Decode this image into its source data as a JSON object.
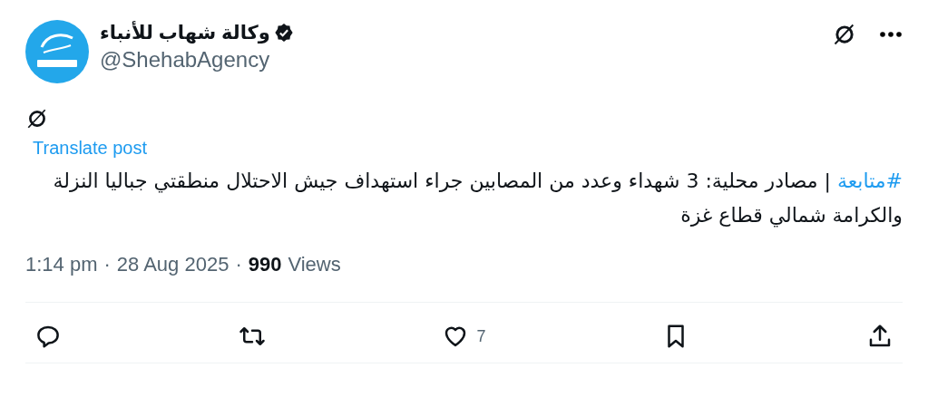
{
  "author": {
    "name": "وكالة شهاب للأنباء",
    "handle": "@ShehabAgency",
    "verified": true
  },
  "translate": {
    "label": "Translate post"
  },
  "post": {
    "hashtag": "#متابعة",
    "text": "| مصادر محلية: 3 شهداء وعدد من المصابين جراء استهداف جيش الاحتلال منطقتي جباليا النزلة والكرامة شمالي قطاع غزة"
  },
  "meta": {
    "time": "1:14 pm",
    "separator_1": "·",
    "date": "28 Aug 2025",
    "separator_2": "·",
    "views_count": "990",
    "views_label": "Views"
  },
  "actions": [
    {
      "kind": "reply"
    },
    {
      "kind": "repost"
    },
    {
      "kind": "like",
      "count": "7"
    },
    {
      "kind": "bookmark"
    },
    {
      "kind": "share"
    }
  ]
}
